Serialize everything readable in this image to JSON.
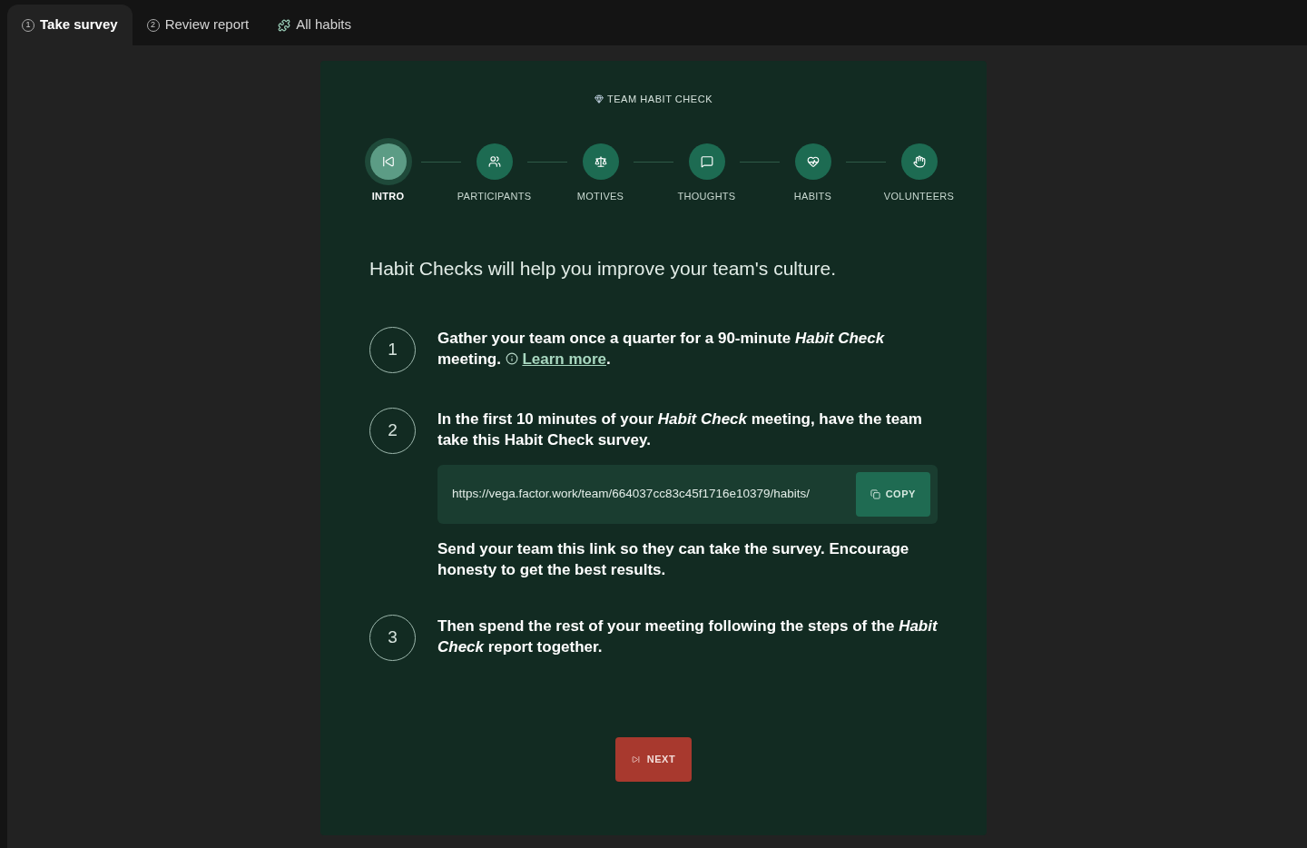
{
  "tabs": [
    {
      "kind": "number",
      "number": "1",
      "label": "Take survey",
      "selected": true
    },
    {
      "kind": "number",
      "number": "2",
      "label": "Review report",
      "selected": false
    },
    {
      "kind": "icon",
      "label": "All habits",
      "selected": false
    }
  ],
  "card": {
    "eyebrow": "TEAM HABIT CHECK",
    "stepper": [
      {
        "label": "INTRO",
        "selected": true
      },
      {
        "label": "PARTICIPANTS",
        "selected": false
      },
      {
        "label": "MOTIVES",
        "selected": false
      },
      {
        "label": "THOUGHTS",
        "selected": false
      },
      {
        "label": "HABITS",
        "selected": false
      },
      {
        "label": "VOLUNTEERS",
        "selected": false
      }
    ],
    "heading": "Habit Checks will help you improve your team's culture.",
    "steps": [
      {
        "number": "1",
        "text": "Gather your team once a quarter for a 90-minute *Habit Check* meeting.",
        "link": "Learn more",
        "link_suffix": "."
      },
      {
        "number": "2",
        "text": "In the first 10 minutes of your *Habit Check* meeting, have the team take this Habit Check survey.",
        "url": "https://vega.factor.work/team/664037cc83c45f1716e10379/habits/",
        "copy_button": "COPY",
        "note": "Send your team this link so they can take the survey. Encourage honesty to get the best results."
      },
      {
        "number": "3",
        "text": "Then spend the rest of your meeting following the steps of the *Habit Check* report together."
      }
    ],
    "next_button": "NEXT"
  }
}
